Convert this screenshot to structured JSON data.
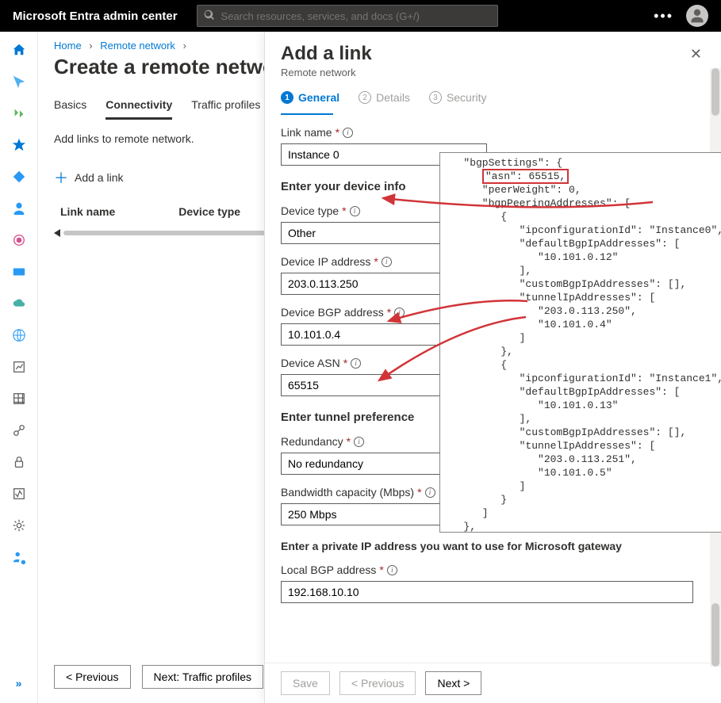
{
  "topbar": {
    "product": "Microsoft Entra admin center",
    "searchPlaceholder": "Search resources, services, and docs (G+/)"
  },
  "breadcrumb": {
    "home": "Home",
    "remote": "Remote network"
  },
  "page": {
    "title": "Create a remote network",
    "tabs": {
      "basics": "Basics",
      "connectivity": "Connectivity",
      "profiles": "Traffic profiles"
    },
    "hint": "Add links to remote network.",
    "addLink": "Add a link",
    "colLinkName": "Link name",
    "colDeviceType": "Device type"
  },
  "bottomButtons": {
    "prev": "< Previous",
    "next": "Next: Traffic profiles"
  },
  "panel": {
    "title": "Add a link",
    "subtitle": "Remote network",
    "steps": {
      "general": "General",
      "details": "Details",
      "security": "Security"
    },
    "labels": {
      "linkName": "Link name",
      "deviceInfo": "Enter your device info",
      "deviceType": "Device type",
      "deviceIp": "Device IP address",
      "deviceBgp": "Device BGP address",
      "deviceAsn": "Device ASN",
      "tunnelPref": "Enter tunnel preference",
      "redundancy": "Redundancy",
      "bandwidth": "Bandwidth capacity (Mbps)",
      "gatewayHint": "Enter a private IP address you want to use for Microsoft gateway",
      "localBgp": "Local BGP address"
    },
    "values": {
      "linkName": "Instance 0",
      "deviceType": "Other",
      "deviceIp": "203.0.113.250",
      "deviceBgp": "10.101.0.4",
      "deviceAsn": "65515",
      "redundancy": "No redundancy",
      "bandwidth": "250 Mbps",
      "localBgp": "192.168.10.10"
    },
    "footer": {
      "save": "Save",
      "prev": "< Previous",
      "next": "Next >"
    }
  },
  "json_overlay": "   \"bgpSettings\": {\n      \"asn\": 65515,\n      \"peerWeight\": 0,\n      \"bgpPeeringAddresses\": [\n         {\n            \"ipconfigurationId\": \"Instance0\",\n            \"defaultBgpIpAddresses\": [\n               \"10.101.0.12\"\n            ],\n            \"customBgpIpAddresses\": [],\n            \"tunnelIpAddresses\": [\n               \"203.0.113.250\",\n               \"10.101.0.4\"\n            ]\n         },\n         {\n            \"ipconfigurationId\": \"Instance1\",\n            \"defaultBgpIpAddresses\": [\n               \"10.101.0.13\"\n            ],\n            \"customBgpIpAddresses\": [],\n            \"tunnelIpAddresses\": [\n               \"203.0.113.251\",\n               \"10.101.0.5\"\n            ]\n         }\n      ]\n   },"
}
